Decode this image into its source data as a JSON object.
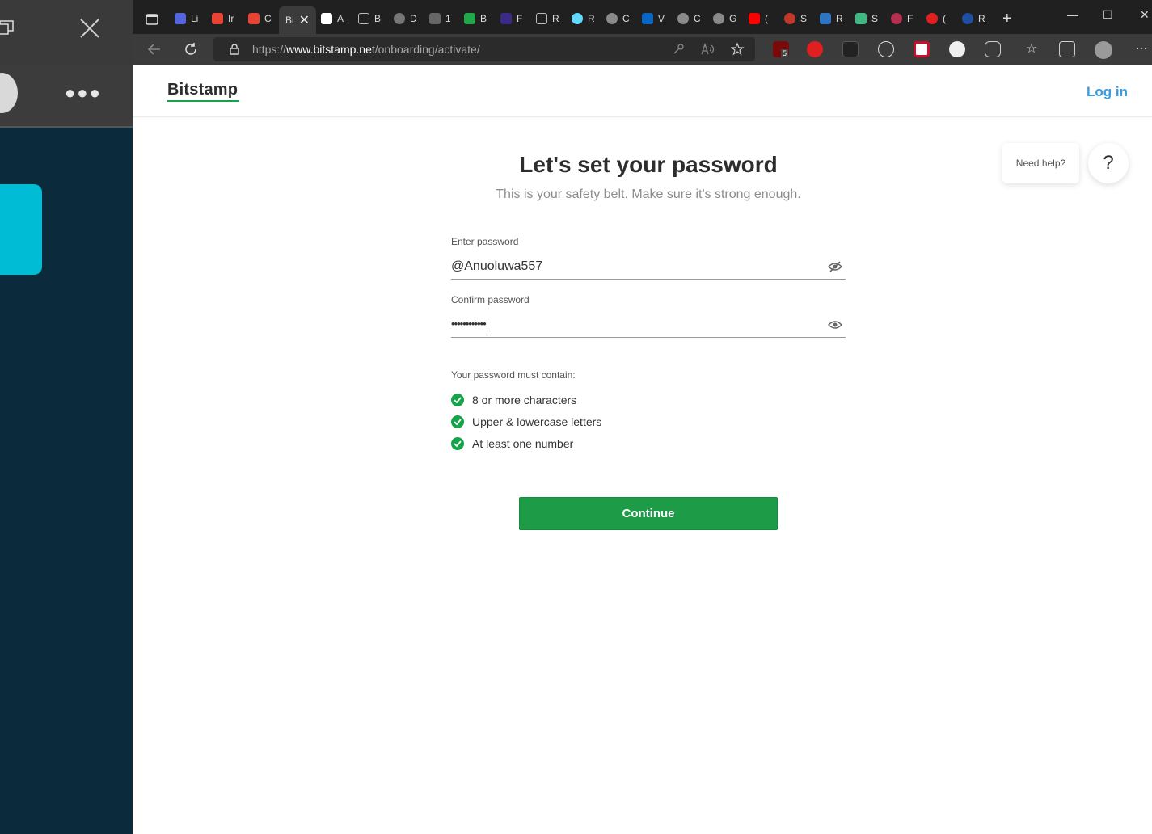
{
  "browser": {
    "url_prefix": "https://",
    "url_host": "www.bitstamp.net",
    "url_path": "/onboarding/activate/",
    "active_tab_label": "Bi",
    "tabs": [
      "Li",
      "Ir",
      "C",
      "Bi",
      "A",
      "B",
      "D",
      "1",
      "B",
      "F",
      "R",
      "R",
      "C",
      "V",
      "C",
      "G",
      "(",
      "S",
      "R",
      "S",
      "F",
      "(",
      "R"
    ],
    "extension_badge": "5"
  },
  "site": {
    "logo": "Bitstamp",
    "login": "Log in"
  },
  "help": {
    "bubble": "Need help?",
    "button": "?"
  },
  "form": {
    "title": "Let's set your password",
    "subtitle": "This is your safety belt. Make sure it's strong enough.",
    "password_label": "Enter password",
    "password_value": "@Anuoluwa557",
    "confirm_label": "Confirm password",
    "confirm_value": "••••••••••••",
    "requirements_title": "Your password must contain:",
    "requirements": [
      "8 or more characters",
      "Upper & lowercase letters",
      "At least one number"
    ],
    "continue_label": "Continue"
  },
  "colors": {
    "accent_green": "#1e9b47",
    "link_blue": "#3b9bdc",
    "side_panel": "#0b2a3c",
    "side_card": "#00bcd4"
  }
}
